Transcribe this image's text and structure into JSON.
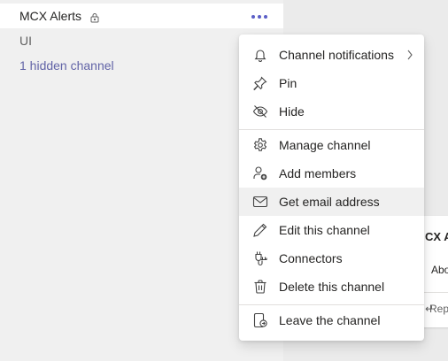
{
  "sidebar": {
    "channel_name": "MCX Alerts",
    "channel_ui": "UI",
    "hidden_link": "1 hidden channel"
  },
  "post_preview": {
    "title_fragment": "CX A",
    "body_fragment": "Abo",
    "reply_fragment": "Rep"
  },
  "menu": {
    "items": [
      {
        "label": "Channel notifications",
        "icon": "bell-icon"
      },
      {
        "label": "Pin",
        "icon": "pin-icon"
      },
      {
        "label": "Hide",
        "icon": "eye-off-icon"
      },
      {
        "label": "Manage channel",
        "icon": "gear-icon"
      },
      {
        "label": "Add members",
        "icon": "add-person-icon"
      },
      {
        "label": "Get email address",
        "icon": "mail-icon"
      },
      {
        "label": "Edit this channel",
        "icon": "pencil-icon"
      },
      {
        "label": "Connectors",
        "icon": "connector-icon"
      },
      {
        "label": "Delete this channel",
        "icon": "trash-icon"
      },
      {
        "label": "Leave the channel",
        "icon": "leave-icon"
      }
    ],
    "highlighted_item": "Get email address"
  },
  "colors": {
    "accent": "#6264a7",
    "more_dots": "#5b5fc7",
    "menu_highlight": "#f0f0f0"
  }
}
